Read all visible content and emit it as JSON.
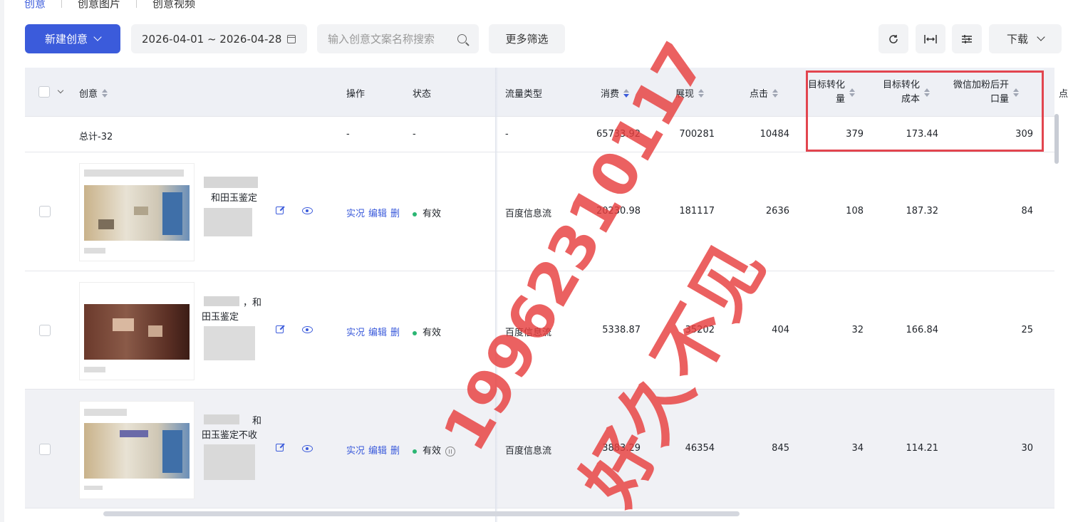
{
  "tabs": [
    "创意",
    "创意图片",
    "创意视频"
  ],
  "toolbar": {
    "new_label": "新建创意",
    "date_range": "2026-04-01 ~ 2026-04-28",
    "search_placeholder": "输入创意文案名称搜索",
    "more_filter": "更多筛选",
    "refresh_icon": "refresh-icon",
    "width_icon": "column-width-icon",
    "settings_icon": "sliders-icon",
    "download_label": "下载"
  },
  "columns": {
    "creative": "创意",
    "action": "操作",
    "status": "状态",
    "traffic": "流量类型",
    "cost": "消费",
    "impressions": "展现",
    "clicks": "点击",
    "target_conv_1": "目标转化",
    "target_conv_2": "量",
    "target_cost_1": "目标转化",
    "target_cost_2": "成本",
    "wechat_1": "微信加粉后开",
    "wechat_2": "口量",
    "extra": "点"
  },
  "total": {
    "label": "总计-32",
    "action": "-",
    "status": "-",
    "traffic": "-",
    "cost": "65733.92",
    "impressions": "700281",
    "clicks": "10484",
    "target_conv": "379",
    "target_cost": "173.44",
    "wechat": "309"
  },
  "rows": [
    {
      "title_lines": [
        "和田玉鉴定"
      ],
      "ops": [
        "实况",
        "编辑",
        "删"
      ],
      "status": "有效",
      "traffic": "百度信息流",
      "cost": "20230.98",
      "impressions": "181117",
      "clicks": "2636",
      "target_conv": "108",
      "target_cost": "187.32",
      "wechat": "84"
    },
    {
      "title_lines": [
        "，和",
        "田玉鉴定"
      ],
      "ops": [
        "实况",
        "编辑",
        "删"
      ],
      "status": "有效",
      "traffic": "百度信息流",
      "cost": "5338.87",
      "impressions": "35202",
      "clicks": "404",
      "target_conv": "32",
      "target_cost": "166.84",
      "wechat": "25"
    },
    {
      "title_lines": [
        "和",
        "田玉鉴定不收"
      ],
      "ops": [
        "实况",
        "编辑",
        "删"
      ],
      "status": "有效",
      "traffic": "百度信息流",
      "cost": "3883.29",
      "impressions": "46354",
      "clicks": "845",
      "target_conv": "34",
      "target_cost": "114.21",
      "wechat": "30"
    }
  ],
  "watermark": {
    "number": "19962310117",
    "text": "好久不见"
  },
  "colors": {
    "primary": "#3b5bdb",
    "status_green": "#2bb673",
    "highlight_red": "#e2454f"
  }
}
